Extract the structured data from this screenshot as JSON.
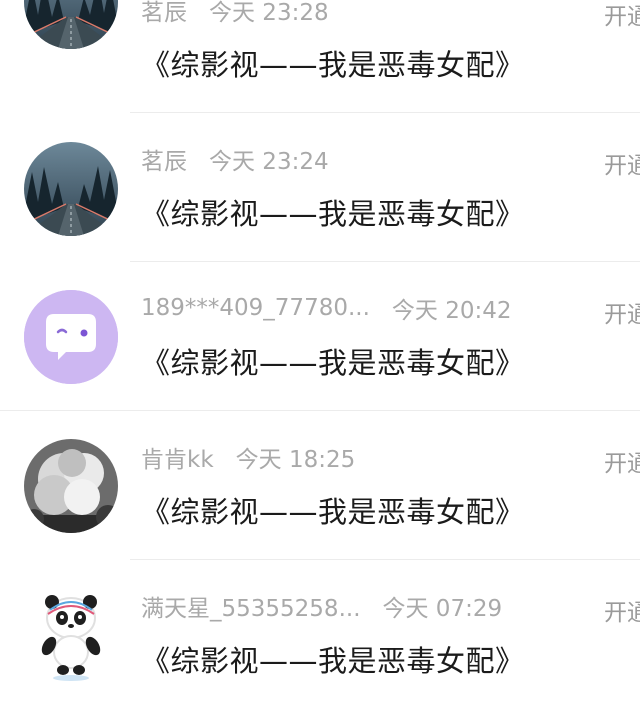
{
  "messages": [
    {
      "name": "茗辰",
      "time": "今天 23:28",
      "title": "《综影视——我是恶毒女配》",
      "action": "开通",
      "avatar": "road-forest-avatar"
    },
    {
      "name": "茗辰",
      "time": "今天 23:24",
      "title": "《综影视——我是恶毒女配》",
      "action": "开通",
      "avatar": "road-forest-avatar"
    },
    {
      "name": "189***409_77780...",
      "time": "今天 20:42",
      "title": "《综影视——我是恶毒女配》",
      "action": "开通",
      "avatar": "default-chat-avatar"
    },
    {
      "name": "肯肯kk",
      "time": "今天 18:25",
      "title": "《综影视——我是恶毒女配》",
      "action": "开通",
      "avatar": "smoke-avatar"
    },
    {
      "name": "满天星_55355258...",
      "time": "今天 07:29",
      "title": "《综影视——我是恶毒女配》",
      "action": "开通",
      "avatar": "panda-mascot-avatar"
    }
  ],
  "colors": {
    "name_text": "#a9a9a9",
    "title_text": "#1b1b1b",
    "default_avatar_bg": "#cdb7f2",
    "divider": "#ececec"
  }
}
